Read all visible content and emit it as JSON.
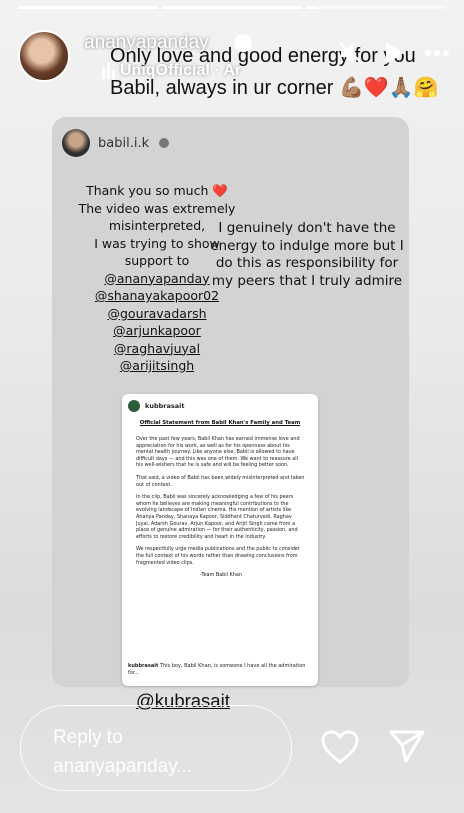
{
  "story": {
    "progress": [
      1.0,
      1.0,
      0.08
    ]
  },
  "header": {
    "username": "ananyapanday",
    "music": "UniqOfficial · Ar",
    "caption": "Only love and good energy for you Babil, always in ur corner 💪🏽❤️🙏🏽🤗"
  },
  "card": {
    "username": "babil.i.k",
    "left_lines": [
      "Thank you so much ❤️",
      "The video was extremely",
      "misinterpreted,",
      "I was trying to show",
      "support to"
    ],
    "mentions": [
      "@ananyapanday",
      "@shanayakapoor02",
      "@gouravadarsh",
      "@arjunkapoor",
      "@raghavjuyal",
      "@arijitsingh"
    ],
    "right_text": "I genuinely don't have the energy to indulge more but I do this as responsibility for my peers that I truly admire"
  },
  "doc": {
    "username": "kubbrasait",
    "title": "Official Statement from Babil Khan's Family and Team",
    "paragraphs": [
      "Over the past few years, Babil Khan has earned immense love and appreciation for his work, as well as for his openness about his mental health journey. Like anyone else, Babil is allowed to have difficult days — and this was one of them. We want to reassure all his well-wishers that he is safe and will be feeling better soon.",
      "That said, a video of Babil has been widely misinterpreted and taken out of context.",
      "In the clip, Babil was sincerely acknowledging a few of his peers whom he believes are making meaningful contributions to the evolving landscape of Indian cinema. His mention of artists like Ananya Panday, Shanaya Kapoor, Siddhant Chaturvedi, Raghav Juyal, Adarsh Gourav, Arjun Kapoor, and Arijit Singh came from a place of genuine admiration — for their authenticity, passion, and efforts to restore credibility and heart in the industry.",
      "We respectfully urge media publications and the public to consider the full context of his words rather than drawing conclusions from fragmented video clips."
    ],
    "sign": "-Team Babil Khan",
    "foot_user": "kubbrasait",
    "foot_text": " This boy, Babil Khan, is someone I have all the admiration for..."
  },
  "mention_tag": "@kubrasait",
  "reply": {
    "placeholder_line1": "Reply to",
    "placeholder_line2": "ananyapanday..."
  },
  "icons": {
    "header": [
      "mute-icon",
      "play-icon",
      "more-icon"
    ],
    "footer": [
      "heart-icon",
      "send-icon"
    ]
  }
}
